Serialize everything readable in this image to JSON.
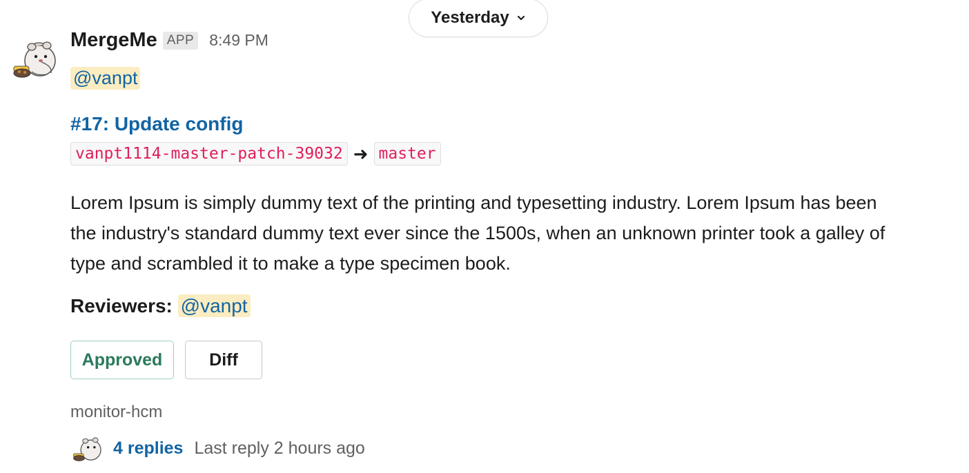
{
  "date_divider": {
    "label": "Yesterday",
    "icon": "chevron-down-icon"
  },
  "message": {
    "sender": "MergeMe",
    "badge": "APP",
    "time": "8:49 PM",
    "mention": "@vanpt",
    "pr_title": "#17: Update config",
    "source_branch": "vanpt1114-master-patch-39032",
    "arrow": "➜",
    "target_branch": "master",
    "description": "Lorem Ipsum is simply dummy text of the printing and typesetting industry. Lorem Ipsum has been the industry's standard dummy text ever since the 1500s, when an unknown printer took a galley of type and scrambled it to make a type specimen book.",
    "reviewers_label": "Reviewers:",
    "reviewer": "@vanpt",
    "buttons": {
      "approved": "Approved",
      "diff": "Diff"
    },
    "channel": "monitor-hcm",
    "thread": {
      "replies": "4 replies",
      "last_reply": "Last reply 2 hours ago"
    }
  },
  "colors": {
    "link": "#1264a3",
    "mention_bg": "#fbedc1",
    "code": "#e01e5a",
    "approved": "#2b7a5b",
    "muted": "#616061"
  }
}
